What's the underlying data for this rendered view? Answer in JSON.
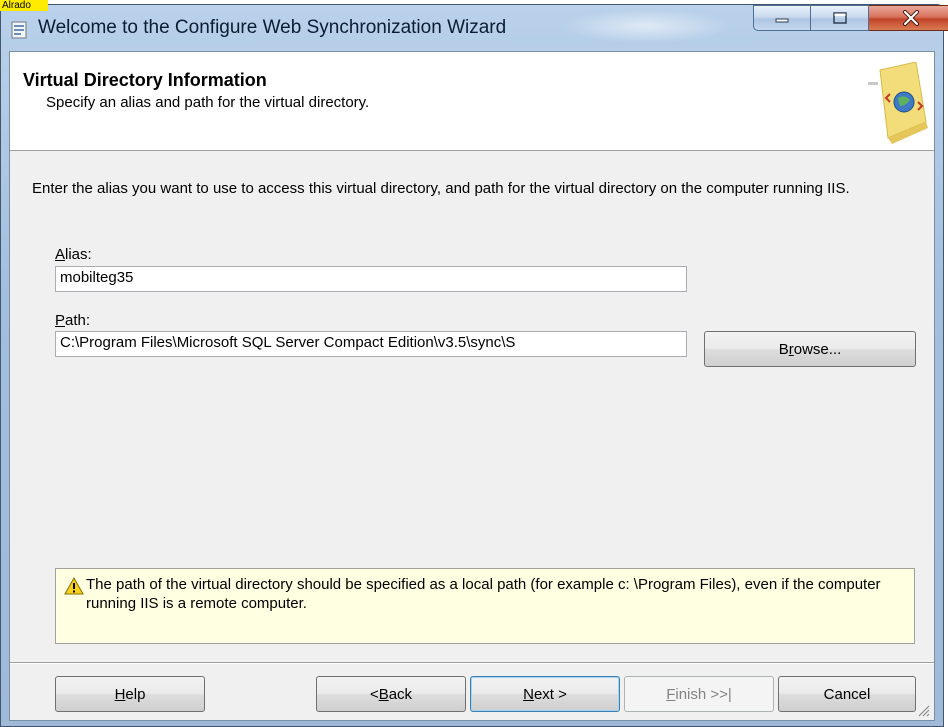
{
  "overlay": {
    "label": "Alrado"
  },
  "window": {
    "title": "Welcome to the Configure Web Synchronization Wizard",
    "app_icon": "wizard-app-icon",
    "controls": {
      "minimize_icon": "minimize-icon",
      "maximize_icon": "maximize-icon",
      "close_icon": "close-icon"
    }
  },
  "header": {
    "title": "Virtual Directory Information",
    "subtitle": "Specify an alias and path for the virtual directory.",
    "graphic": "web-sync-globe-graphic"
  },
  "body": {
    "instructions": "Enter the alias you want to use to access this virtual directory, and path for the virtual directory on the computer running IIS.",
    "alias": {
      "label_mnemonic": "A",
      "label_rest": "lias:",
      "value": "mobilteg35"
    },
    "path": {
      "label_mnemonic": "P",
      "label_rest": "ath:",
      "value": "C:\\Program Files\\Microsoft SQL Server Compact Edition\\v3.5\\sync\\S"
    },
    "browse": {
      "pre": "B",
      "mnemonic": "r",
      "post": "owse..."
    }
  },
  "warning": {
    "icon": "warning-icon",
    "text": "The path of the virtual directory should be specified as a local path (for example c: \\Program Files), even if the computer running IIS is a remote computer."
  },
  "footer": {
    "help": {
      "mnemonic": "H",
      "rest": "elp"
    },
    "back": {
      "pre": "< ",
      "mnemonic": "B",
      "rest": "ack"
    },
    "next": {
      "mnemonic": "N",
      "rest": "ext >"
    },
    "finish": {
      "mnemonic": "F",
      "rest": "inish >>|",
      "enabled": false
    },
    "cancel": {
      "label": "Cancel"
    }
  },
  "colors": {
    "accent": "#3c7fb1",
    "warning_bg": "#ffffe1",
    "highlight": "#ffeb00"
  }
}
